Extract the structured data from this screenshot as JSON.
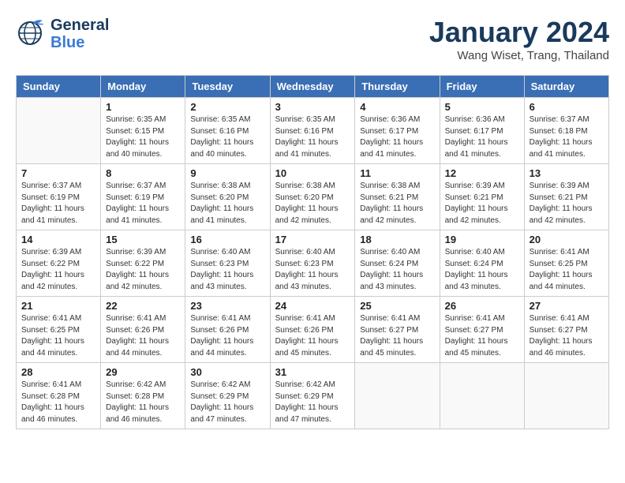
{
  "header": {
    "logo_line1": "General",
    "logo_line2": "Blue",
    "month": "January 2024",
    "location": "Wang Wiset, Trang, Thailand"
  },
  "weekdays": [
    "Sunday",
    "Monday",
    "Tuesday",
    "Wednesday",
    "Thursday",
    "Friday",
    "Saturday"
  ],
  "weeks": [
    [
      {
        "day": "",
        "info": ""
      },
      {
        "day": "1",
        "info": "Sunrise: 6:35 AM\nSunset: 6:15 PM\nDaylight: 11 hours\nand 40 minutes."
      },
      {
        "day": "2",
        "info": "Sunrise: 6:35 AM\nSunset: 6:16 PM\nDaylight: 11 hours\nand 40 minutes."
      },
      {
        "day": "3",
        "info": "Sunrise: 6:35 AM\nSunset: 6:16 PM\nDaylight: 11 hours\nand 41 minutes."
      },
      {
        "day": "4",
        "info": "Sunrise: 6:36 AM\nSunset: 6:17 PM\nDaylight: 11 hours\nand 41 minutes."
      },
      {
        "day": "5",
        "info": "Sunrise: 6:36 AM\nSunset: 6:17 PM\nDaylight: 11 hours\nand 41 minutes."
      },
      {
        "day": "6",
        "info": "Sunrise: 6:37 AM\nSunset: 6:18 PM\nDaylight: 11 hours\nand 41 minutes."
      }
    ],
    [
      {
        "day": "7",
        "info": "Sunrise: 6:37 AM\nSunset: 6:19 PM\nDaylight: 11 hours\nand 41 minutes."
      },
      {
        "day": "8",
        "info": "Sunrise: 6:37 AM\nSunset: 6:19 PM\nDaylight: 11 hours\nand 41 minutes."
      },
      {
        "day": "9",
        "info": "Sunrise: 6:38 AM\nSunset: 6:20 PM\nDaylight: 11 hours\nand 41 minutes."
      },
      {
        "day": "10",
        "info": "Sunrise: 6:38 AM\nSunset: 6:20 PM\nDaylight: 11 hours\nand 42 minutes."
      },
      {
        "day": "11",
        "info": "Sunrise: 6:38 AM\nSunset: 6:21 PM\nDaylight: 11 hours\nand 42 minutes."
      },
      {
        "day": "12",
        "info": "Sunrise: 6:39 AM\nSunset: 6:21 PM\nDaylight: 11 hours\nand 42 minutes."
      },
      {
        "day": "13",
        "info": "Sunrise: 6:39 AM\nSunset: 6:21 PM\nDaylight: 11 hours\nand 42 minutes."
      }
    ],
    [
      {
        "day": "14",
        "info": "Sunrise: 6:39 AM\nSunset: 6:22 PM\nDaylight: 11 hours\nand 42 minutes."
      },
      {
        "day": "15",
        "info": "Sunrise: 6:39 AM\nSunset: 6:22 PM\nDaylight: 11 hours\nand 42 minutes."
      },
      {
        "day": "16",
        "info": "Sunrise: 6:40 AM\nSunset: 6:23 PM\nDaylight: 11 hours\nand 43 minutes."
      },
      {
        "day": "17",
        "info": "Sunrise: 6:40 AM\nSunset: 6:23 PM\nDaylight: 11 hours\nand 43 minutes."
      },
      {
        "day": "18",
        "info": "Sunrise: 6:40 AM\nSunset: 6:24 PM\nDaylight: 11 hours\nand 43 minutes."
      },
      {
        "day": "19",
        "info": "Sunrise: 6:40 AM\nSunset: 6:24 PM\nDaylight: 11 hours\nand 43 minutes."
      },
      {
        "day": "20",
        "info": "Sunrise: 6:41 AM\nSunset: 6:25 PM\nDaylight: 11 hours\nand 44 minutes."
      }
    ],
    [
      {
        "day": "21",
        "info": "Sunrise: 6:41 AM\nSunset: 6:25 PM\nDaylight: 11 hours\nand 44 minutes."
      },
      {
        "day": "22",
        "info": "Sunrise: 6:41 AM\nSunset: 6:26 PM\nDaylight: 11 hours\nand 44 minutes."
      },
      {
        "day": "23",
        "info": "Sunrise: 6:41 AM\nSunset: 6:26 PM\nDaylight: 11 hours\nand 44 minutes."
      },
      {
        "day": "24",
        "info": "Sunrise: 6:41 AM\nSunset: 6:26 PM\nDaylight: 11 hours\nand 45 minutes."
      },
      {
        "day": "25",
        "info": "Sunrise: 6:41 AM\nSunset: 6:27 PM\nDaylight: 11 hours\nand 45 minutes."
      },
      {
        "day": "26",
        "info": "Sunrise: 6:41 AM\nSunset: 6:27 PM\nDaylight: 11 hours\nand 45 minutes."
      },
      {
        "day": "27",
        "info": "Sunrise: 6:41 AM\nSunset: 6:27 PM\nDaylight: 11 hours\nand 46 minutes."
      }
    ],
    [
      {
        "day": "28",
        "info": "Sunrise: 6:41 AM\nSunset: 6:28 PM\nDaylight: 11 hours\nand 46 minutes."
      },
      {
        "day": "29",
        "info": "Sunrise: 6:42 AM\nSunset: 6:28 PM\nDaylight: 11 hours\nand 46 minutes."
      },
      {
        "day": "30",
        "info": "Sunrise: 6:42 AM\nSunset: 6:29 PM\nDaylight: 11 hours\nand 47 minutes."
      },
      {
        "day": "31",
        "info": "Sunrise: 6:42 AM\nSunset: 6:29 PM\nDaylight: 11 hours\nand 47 minutes."
      },
      {
        "day": "",
        "info": ""
      },
      {
        "day": "",
        "info": ""
      },
      {
        "day": "",
        "info": ""
      }
    ]
  ]
}
